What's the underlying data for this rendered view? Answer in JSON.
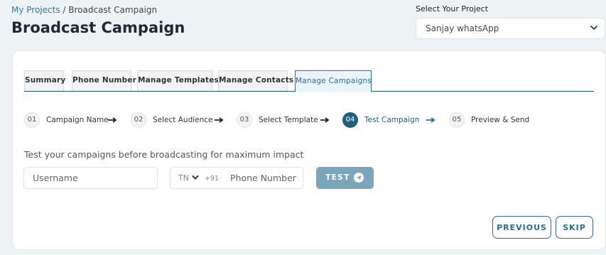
{
  "breadcrumb": {
    "link": "My Projects",
    "separator": " / ",
    "current": "Broadcast Campaign"
  },
  "page_title": "Broadcast Campaign",
  "project_selector": {
    "label": "Select Your Project",
    "value": "Sanjay whatsApp"
  },
  "tabs": [
    {
      "label": "Summary"
    },
    {
      "label": "Phone Number"
    },
    {
      "label": "Manage Templates"
    },
    {
      "label": "Manage Contacts"
    },
    {
      "label": "Manage Campaigns",
      "active": true
    }
  ],
  "steps": [
    {
      "num": "01",
      "label": "Campaign Name"
    },
    {
      "num": "02",
      "label": "Select Audience"
    },
    {
      "num": "03",
      "label": "Select Template"
    },
    {
      "num": "04",
      "label": "Test Campaign",
      "active": true
    },
    {
      "num": "05",
      "label": "Preview & Send"
    }
  ],
  "test_form": {
    "hint": "Test your campaigns before broadcasting for maximum impact",
    "username_placeholder": "Username",
    "country_code": "TN",
    "dial_code": "+91",
    "phone_placeholder": "Phone Number",
    "test_button": "TEST"
  },
  "footer": {
    "previous_button": "PREVIOUS",
    "skip_button": "SKIP"
  },
  "colors": {
    "accent": "#1e5f80",
    "test_button": "#7aa5bb",
    "background": "#edf2f5"
  }
}
